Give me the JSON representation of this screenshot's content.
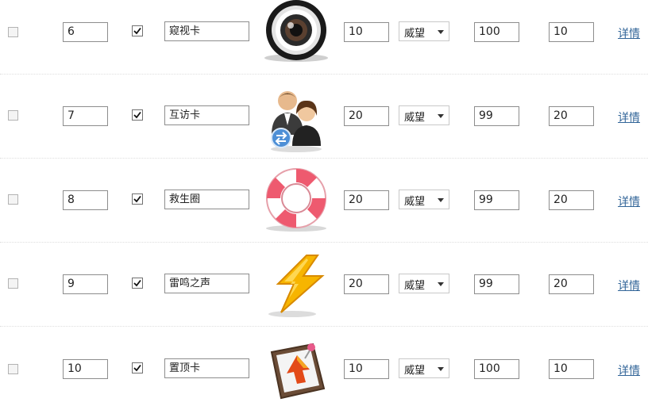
{
  "rows": [
    {
      "order": "6",
      "name": "窥视卡",
      "icon": "eye-lens-icon",
      "price": "10",
      "credit": "威望",
      "stock": "100",
      "limit": "10",
      "detail": "详情"
    },
    {
      "order": "7",
      "name": "互访卡",
      "icon": "user-swap-icon",
      "price": "20",
      "credit": "威望",
      "stock": "99",
      "limit": "20",
      "detail": "详情"
    },
    {
      "order": "8",
      "name": "救生圈",
      "icon": "life-ring-icon",
      "price": "20",
      "credit": "威望",
      "stock": "99",
      "limit": "20",
      "detail": "详情"
    },
    {
      "order": "9",
      "name": "雷鸣之声",
      "icon": "lightning-icon",
      "price": "20",
      "credit": "威望",
      "stock": "99",
      "limit": "20",
      "detail": "详情"
    },
    {
      "order": "10",
      "name": "置顶卡",
      "icon": "pin-to-top-icon",
      "price": "10",
      "credit": "威望",
      "stock": "100",
      "limit": "10",
      "detail": "详情"
    }
  ]
}
